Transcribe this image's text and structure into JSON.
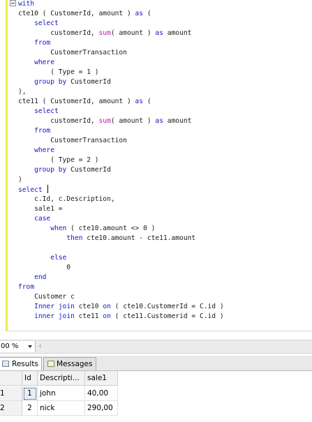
{
  "editor": {
    "lines": [
      [
        {
          "t": "with",
          "c": "kw"
        }
      ],
      [
        {
          "t": "cte10 ( CustomerId, amount ) "
        },
        {
          "t": "as",
          "c": "kw"
        },
        {
          "t": " ("
        }
      ],
      [
        {
          "t": "    "
        },
        {
          "t": "select",
          "c": "kw"
        }
      ],
      [
        {
          "t": "        customerId, "
        },
        {
          "t": "sum",
          "c": "fn"
        },
        {
          "t": "( amount ) "
        },
        {
          "t": "as",
          "c": "kw"
        },
        {
          "t": " amount"
        }
      ],
      [
        {
          "t": "    "
        },
        {
          "t": "from",
          "c": "kw"
        }
      ],
      [
        {
          "t": "        CustomerTransaction"
        }
      ],
      [
        {
          "t": "    "
        },
        {
          "t": "where",
          "c": "kw"
        }
      ],
      [
        {
          "t": "        ( Type = 1 )"
        }
      ],
      [
        {
          "t": "    "
        },
        {
          "t": "group by",
          "c": "kw"
        },
        {
          "t": " CustomerId"
        }
      ],
      [
        {
          "t": "),"
        }
      ],
      [
        {
          "t": "cte11 ( CustomerId, amount ) "
        },
        {
          "t": "as",
          "c": "kw"
        },
        {
          "t": " ("
        }
      ],
      [
        {
          "t": "    "
        },
        {
          "t": "select",
          "c": "kw"
        }
      ],
      [
        {
          "t": "        customerId, "
        },
        {
          "t": "sum",
          "c": "fn"
        },
        {
          "t": "( amount ) "
        },
        {
          "t": "as",
          "c": "kw"
        },
        {
          "t": " amount"
        }
      ],
      [
        {
          "t": "    "
        },
        {
          "t": "from",
          "c": "kw"
        }
      ],
      [
        {
          "t": "        CustomerTransaction"
        }
      ],
      [
        {
          "t": "    "
        },
        {
          "t": "where",
          "c": "kw"
        }
      ],
      [
        {
          "t": "        ( Type = 2 )"
        }
      ],
      [
        {
          "t": "    "
        },
        {
          "t": "group by",
          "c": "kw"
        },
        {
          "t": " CustomerId"
        }
      ],
      [
        {
          "t": ")"
        }
      ],
      [
        {
          "t": "select",
          "c": "kw"
        },
        {
          "t": " ",
          "caret": true
        }
      ],
      [
        {
          "t": "    c.Id, c.Description,"
        }
      ],
      [
        {
          "t": "    sale1 ="
        }
      ],
      [
        {
          "t": "    "
        },
        {
          "t": "case",
          "c": "kw"
        }
      ],
      [
        {
          "t": "        "
        },
        {
          "t": "when",
          "c": "kw"
        },
        {
          "t": " ( cte10.amount <> 0 )"
        }
      ],
      [
        {
          "t": "            "
        },
        {
          "t": "then",
          "c": "kw"
        },
        {
          "t": " cte10.amount - cte11.amount"
        }
      ],
      [
        {
          "t": ""
        }
      ],
      [
        {
          "t": "        "
        },
        {
          "t": "else",
          "c": "kw"
        }
      ],
      [
        {
          "t": "            0"
        }
      ],
      [
        {
          "t": "    "
        },
        {
          "t": "end",
          "c": "kw"
        }
      ],
      [
        {
          "t": "from",
          "c": "kw"
        }
      ],
      [
        {
          "t": "    Customer c"
        }
      ],
      [
        {
          "t": "    "
        },
        {
          "t": "Inner join",
          "c": "kw"
        },
        {
          "t": " cte10 "
        },
        {
          "t": "on",
          "c": "kw"
        },
        {
          "t": " ( cte10.CustomerId = C.id )"
        }
      ],
      [
        {
          "t": "    "
        },
        {
          "t": "inner join",
          "c": "kw"
        },
        {
          "t": " cte11 "
        },
        {
          "t": "on",
          "c": "kw"
        },
        {
          "t": " ( cte11.Customerid = C.id )"
        }
      ]
    ]
  },
  "zoom": {
    "value": "00 %"
  },
  "tabs": {
    "results_label": "Results",
    "messages_label": "Messages"
  },
  "grid": {
    "headers": [
      "Id",
      "Descripti...",
      "sale1"
    ],
    "rows": [
      {
        "row_no": "1",
        "id": "1",
        "description": "john",
        "sale1": "40,00"
      },
      {
        "row_no": "2",
        "id": "2",
        "description": "nick",
        "sale1": "290,00"
      }
    ]
  },
  "colors": {
    "keyword": "#1515c8",
    "function": "#c21ab1",
    "change_margin": "#f5e94c"
  }
}
